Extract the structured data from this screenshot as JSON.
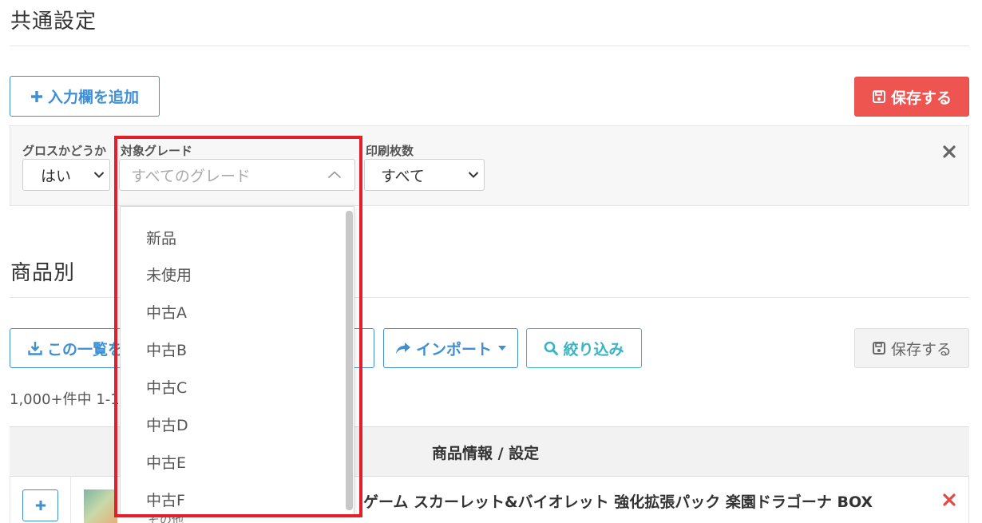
{
  "common_settings": {
    "title": "共通設定",
    "add_field_label": "入力欄を追加",
    "save_label": "保存する",
    "filters": {
      "gloss": {
        "label": "グロスかどうか",
        "value": "はい"
      },
      "grade": {
        "label": "対象グレード",
        "placeholder": "すべてのグレード",
        "options": [
          "新品",
          "未使用",
          "中古A",
          "中古B",
          "中古C",
          "中古D",
          "中古E",
          "中古F"
        ]
      },
      "print_count": {
        "label": "印刷枚数",
        "value": "すべて"
      }
    }
  },
  "per_product": {
    "title": "商品別",
    "export_label": "この一覧を",
    "import_label": "インポート",
    "filter_label": "絞り込み",
    "save_label": "保存する",
    "count_text": "1,000+件中 1-1",
    "table_header": "商品情報 / 設定",
    "row": {
      "name": "ゲーム スカーレット&バイオレット 強化拡張パック 楽園ドラゴーナ BOX",
      "sub": "その他"
    }
  },
  "colors": {
    "primary": "#3f8fd2",
    "teal": "#3bb3c3",
    "danger": "#ee5450",
    "highlight": "#e3202a"
  },
  "icons": [
    "plus-icon",
    "save-icon",
    "chevron-down-icon",
    "chevron-up-icon",
    "close-icon",
    "download-icon",
    "share-icon",
    "caret-down-icon",
    "search-icon"
  ]
}
